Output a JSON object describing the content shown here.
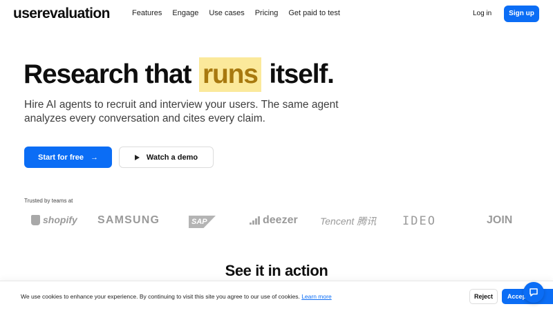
{
  "header": {
    "logo": "userevaluation",
    "nav": [
      "Features",
      "Engage",
      "Use cases",
      "Pricing",
      "Get paid to test"
    ],
    "login": "Log in",
    "signup": "Sign up"
  },
  "hero": {
    "title_before": "Research that",
    "title_highlight": "runs",
    "title_after": "itself.",
    "subtitle": "Hire AI agents to recruit and interview your users. The same agent analyzes every conversation and cites every claim.",
    "primary_cta": "Start for free",
    "secondary_cta": "Watch a demo"
  },
  "trusted": {
    "label": "Trusted by teams at",
    "logos": [
      "shopify",
      "SAMSUNG",
      "SAP",
      "deezer",
      "Tencent 腾讯",
      "IDEO",
      "JOIN"
    ]
  },
  "section": {
    "title": "See it in action"
  },
  "cookie": {
    "text": "We use cookies to enhance your experience. By continuing to visit this site you agree to our use of cookies.",
    "link": "Learn more",
    "reject": "Reject",
    "accept": "Accep"
  },
  "colors": {
    "accent": "#0b6df5",
    "highlight_bg": "#fbe99b",
    "highlight_text": "#a8790f"
  },
  "icons": {
    "arrow": "arrow-right-icon",
    "play": "play-icon",
    "chat": "chat-bubble-icon"
  }
}
